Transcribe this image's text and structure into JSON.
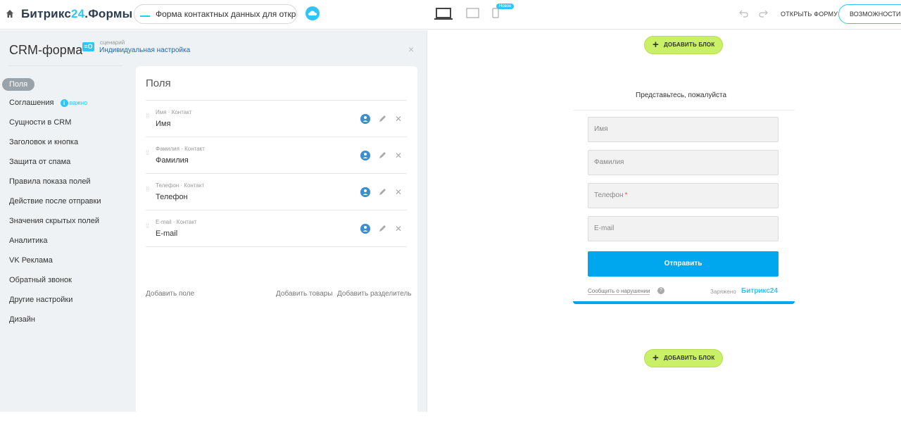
{
  "topbar": {
    "logo_main": "Битрикс",
    "logo_num": "24",
    "logo_suffix": ".Формы",
    "form_title": "Форма контактных данных для открыт...",
    "new_badge": "Новое",
    "open_form": "ОТКРЫТЬ ФОРМУ",
    "features": "ВОЗМОЖНОСТИ ФОРМ"
  },
  "panel": {
    "title": "CRM-форма",
    "scenario_icon": "≡O",
    "scenario_caption": "сценарий",
    "scenario_value": "Индивидуальная настройка",
    "close": "×"
  },
  "nav": {
    "items": [
      {
        "label": "Поля"
      },
      {
        "label": "Соглашения",
        "badge": "важно"
      },
      {
        "label": "Сущности в CRM"
      },
      {
        "label": "Заголовок и кнопка"
      },
      {
        "label": "Защита от спама"
      },
      {
        "label": "Правила показа полей"
      },
      {
        "label": "Действие после отправки"
      },
      {
        "label": "Значения скрытых полей"
      },
      {
        "label": "Аналитика"
      },
      {
        "label": "VK Реклама"
      },
      {
        "label": "Обратный звонок"
      },
      {
        "label": "Другие настройки"
      },
      {
        "label": "Дизайн"
      }
    ]
  },
  "fields_card": {
    "title": "Поля",
    "fields": [
      {
        "caption": "Имя · Контакт",
        "name": "Имя"
      },
      {
        "caption": "Фамилия · Контакт",
        "name": "Фамилия"
      },
      {
        "caption": "Телефон · Контакт",
        "name": "Телефон"
      },
      {
        "caption": "E-mail · Контакт",
        "name": "E-mail"
      }
    ],
    "add_field": "Добавить поле",
    "add_products": "Добавить товары",
    "add_separator": "Добавить разделитель"
  },
  "preview": {
    "add_block": "ДОБАВИТЬ БЛОК",
    "heading": "Представьтесь, пожалуйста",
    "inputs": [
      {
        "placeholder": "Имя"
      },
      {
        "placeholder": "Фамилия"
      },
      {
        "placeholder": "Телефон",
        "required": "*"
      },
      {
        "placeholder": "E-mail"
      }
    ],
    "submit": "Отправить",
    "report": "Сообщить о нарушении",
    "charged_by": "Заряжено",
    "brand": "Битрикс24"
  },
  "colors": {
    "accent": "#2fc6f6",
    "submit": "#00a6ee",
    "add_block": "#c9f067",
    "panel_bg": "#eef2f4"
  }
}
